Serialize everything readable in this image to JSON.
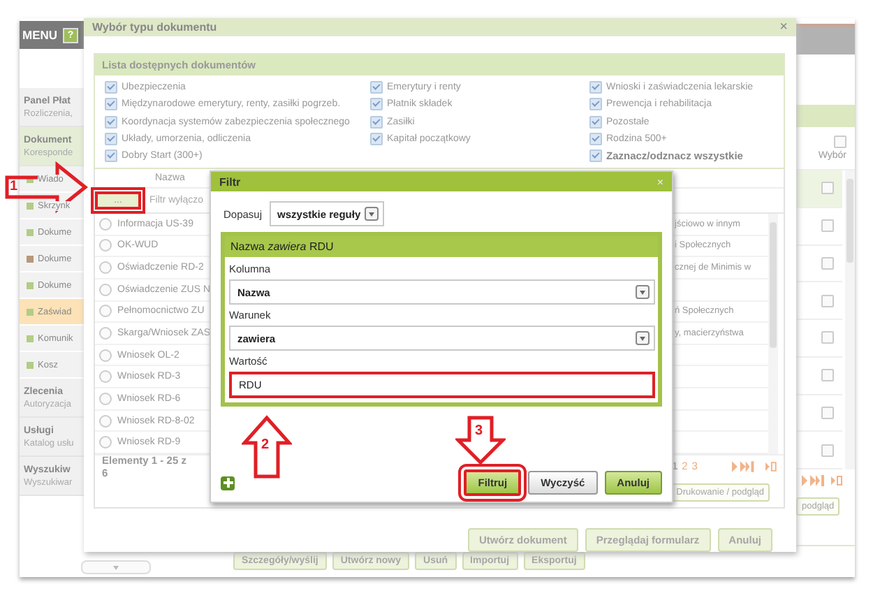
{
  "menu": {
    "title": "MENU",
    "help": "?"
  },
  "sidebar": {
    "sections": [
      {
        "title": "Panel Płat",
        "subtitle": "Rozliczenia,",
        "selected": false
      },
      {
        "title": "Dokument",
        "subtitle": "Koresponde",
        "selected": true,
        "items": [
          {
            "label": "Wiado",
            "color": "#b3cc86",
            "selected": false
          },
          {
            "label": "Skrzynk",
            "color": "#b3cc86",
            "selected": false
          },
          {
            "label": "Dokume",
            "color": "#b3cc86",
            "selected": false
          },
          {
            "label": "Dokume",
            "color": "#b8977a",
            "selected": false
          },
          {
            "label": "Dokume",
            "color": "#b3cc86",
            "selected": false
          },
          {
            "label": "Zaświad",
            "color": "#b3cc86",
            "selected": true
          },
          {
            "label": "Komunik",
            "color": "#b3cc86",
            "selected": false
          },
          {
            "label": "Kosz",
            "color": "#b3cc86",
            "selected": false
          }
        ]
      },
      {
        "title": "Zlecenia",
        "subtitle": "Autoryzacja",
        "selected": false
      },
      {
        "title": "Usługi",
        "subtitle": "Katalog usłu",
        "selected": false
      },
      {
        "title": "Wyszukiw",
        "subtitle": "Wyszukiwar",
        "selected": false
      }
    ]
  },
  "background_table": {
    "column": "Wybór",
    "header_checked": false,
    "rows": [
      {
        "checked": false,
        "selected": true
      },
      {
        "checked": false,
        "selected": false
      },
      {
        "checked": false,
        "selected": false
      },
      {
        "checked": false,
        "selected": false
      },
      {
        "checked": false,
        "selected": false
      },
      {
        "checked": false,
        "selected": false
      },
      {
        "checked": false,
        "selected": false
      },
      {
        "checked": false,
        "selected": false
      }
    ],
    "print_button": "podgląd"
  },
  "toolbar": [
    "Szczegóły/wyślij",
    "Utwórz nowy",
    "Usuń",
    "Importuj",
    "Eksportuj"
  ],
  "document_dialog": {
    "title": "Wybór typu dokumentu",
    "close": "×",
    "panel_title": "Lista dostępnych dokumentów",
    "categories": [
      {
        "items": [
          {
            "label": "Ubezpieczenia",
            "checked": true,
            "kind": "category"
          },
          {
            "label": "Międzynarodowe emerytury, renty, zasiłki pogrzeb.",
            "checked": true,
            "kind": "category"
          },
          {
            "label": "Koordynacja systemów zabezpieczenia społecznego",
            "checked": true,
            "kind": "category"
          },
          {
            "label": "Układy, umorzenia, odliczenia",
            "checked": true,
            "kind": "category"
          },
          {
            "label": "Dobry Start (300+)",
            "checked": true,
            "kind": "category"
          }
        ]
      },
      {
        "items": [
          {
            "label": "Emerytury i renty",
            "checked": true,
            "kind": "category"
          },
          {
            "label": "Płatnik składek",
            "checked": true,
            "kind": "category"
          },
          {
            "label": "Zasiłki",
            "checked": true,
            "kind": "category"
          },
          {
            "label": "Kapitał początkowy",
            "checked": true,
            "kind": "category"
          }
        ]
      },
      {
        "items": [
          {
            "label": "Wnioski i zaświadczenia lekarskie",
            "checked": true,
            "kind": "category"
          },
          {
            "label": "Prewencja i rehabilitacja",
            "checked": true,
            "kind": "category"
          },
          {
            "label": "Pozostałe",
            "checked": true,
            "kind": "category"
          },
          {
            "label": "Rodzina 500+",
            "checked": true,
            "kind": "category"
          },
          {
            "label": "Zaznacz/odznacz wszystkie",
            "checked": true,
            "kind": "toggle_all"
          }
        ]
      }
    ],
    "grid": {
      "column": "Nazwa",
      "filter_button": "...",
      "filter_button_highlighted": true,
      "filter_text": "Filtr wyłączo",
      "rows": [
        {
          "name": "Informacja US-39",
          "column_2": "jściowo w innym",
          "selected": false
        },
        {
          "name": "OK-WUD",
          "column_2": "i Społecznych",
          "selected": false
        },
        {
          "name": "Oświadczenie RD-2",
          "column_2": "cznej de Minimis w",
          "selected": false
        },
        {
          "name": "Oświadczenie ZUS N",
          "selected": false
        },
        {
          "name": "Pełnomocnictwo ZU",
          "column_2": "ń Społecznych",
          "selected": false
        },
        {
          "name": "Skarga/Wniosek ZAS",
          "column_2": "y, macierzyństwa",
          "selected": false
        },
        {
          "name": "Wniosek OL-2",
          "selected": false
        },
        {
          "name": "Wniosek RD-3",
          "selected": false
        },
        {
          "name": "Wniosek RD-6",
          "selected": false
        },
        {
          "name": "Wniosek RD-8-02",
          "selected": false
        },
        {
          "name": "Wniosek RD-9",
          "selected": false
        }
      ],
      "pager_text": "Elementy 1 - 25 z 6",
      "pages": [
        {
          "label": "1",
          "selected": true
        },
        {
          "label": "2",
          "selected": false
        },
        {
          "label": "3",
          "selected": false
        }
      ],
      "print_button": "Drukowanie / podgląd"
    },
    "buttons": [
      "Utwórz dokument",
      "Przeglądaj formularz",
      "Anuluj"
    ]
  },
  "filter_dialog": {
    "title": "Filtr",
    "close": "×",
    "match_label": "Dopasuj",
    "match_value": "wszystkie reguły",
    "rule": {
      "summary": "Nazwa *zawiera* RDU",
      "column_label": "Kolumna",
      "column_value": "Nazwa",
      "condition_label": "Warunek",
      "condition_value": "zawiera",
      "value_label": "Wartość",
      "value": "RDU",
      "value_highlighted": true
    },
    "buttons": [
      {
        "label": "Filtruj",
        "kind": "primary",
        "highlighted": true
      },
      {
        "label": "Wyczyść",
        "kind": "secondary",
        "highlighted": false
      },
      {
        "label": "Anuluj",
        "kind": "primary",
        "highlighted": false
      }
    ]
  },
  "annotations": [
    {
      "kind": "arrow-right",
      "label": "1"
    },
    {
      "kind": "arrow-up",
      "label": "2"
    },
    {
      "kind": "arrow-down",
      "label": "3"
    }
  ]
}
